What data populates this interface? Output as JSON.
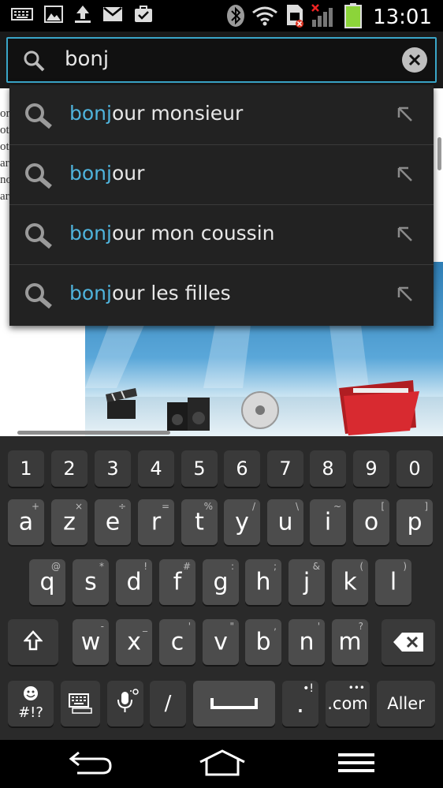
{
  "status_bar": {
    "time": "13:01",
    "left_icons": [
      "keyboard-icon",
      "image-icon",
      "upload-icon",
      "gmail-icon",
      "task-icon"
    ],
    "right_icons": [
      "bluetooth-icon",
      "wifi-icon",
      "sim-error-icon",
      "signal-icon",
      "battery-icon"
    ]
  },
  "search": {
    "query": "bonj",
    "placeholder": ""
  },
  "page": {
    "left_text_lines": [
      "or",
      "ot",
      "ot",
      "ar",
      "no",
      "ar"
    ]
  },
  "suggestions": [
    {
      "match": "bonj",
      "rest": "our monsieur"
    },
    {
      "match": "bonj",
      "rest": "our"
    },
    {
      "match": "bonj",
      "rest": "our mon coussin"
    },
    {
      "match": "bonj",
      "rest": "our les filles"
    }
  ],
  "keyboard": {
    "numbers": [
      "1",
      "2",
      "3",
      "4",
      "5",
      "6",
      "7",
      "8",
      "9",
      "0"
    ],
    "row1": [
      {
        "key": "a",
        "sup": "+"
      },
      {
        "key": "z",
        "sup": "×"
      },
      {
        "key": "e",
        "sup": "÷"
      },
      {
        "key": "r",
        "sup": "="
      },
      {
        "key": "t",
        "sup": "%"
      },
      {
        "key": "y",
        "sup": "/"
      },
      {
        "key": "u",
        "sup": "\\"
      },
      {
        "key": "i",
        "sup": "~"
      },
      {
        "key": "o",
        "sup": "["
      },
      {
        "key": "p",
        "sup": "]"
      }
    ],
    "row2": [
      {
        "key": "q",
        "sup": "@"
      },
      {
        "key": "s",
        "sup": "*"
      },
      {
        "key": "d",
        "sup": "!"
      },
      {
        "key": "f",
        "sup": "#"
      },
      {
        "key": "g",
        "sup": ":"
      },
      {
        "key": "h",
        "sup": ";"
      },
      {
        "key": "j",
        "sup": "&"
      },
      {
        "key": "k",
        "sup": "("
      },
      {
        "key": "l",
        "sup": ")"
      }
    ],
    "row3": [
      {
        "key": "w",
        "sup": "-"
      },
      {
        "key": "x",
        "sup": "_"
      },
      {
        "key": "c",
        "sup": "'"
      },
      {
        "key": "v",
        "sup": "\""
      },
      {
        "key": "b",
        "sup": ","
      },
      {
        "key": "n",
        "sup": "'"
      },
      {
        "key": "m",
        "sup": "?"
      }
    ],
    "symbols_label": "#!?",
    "slash_label": "/",
    "period_label": ".",
    "period_sup": "•!",
    "dotcom_label": ".com",
    "dotcom_sup": "•••",
    "enter_label": "Aller"
  }
}
